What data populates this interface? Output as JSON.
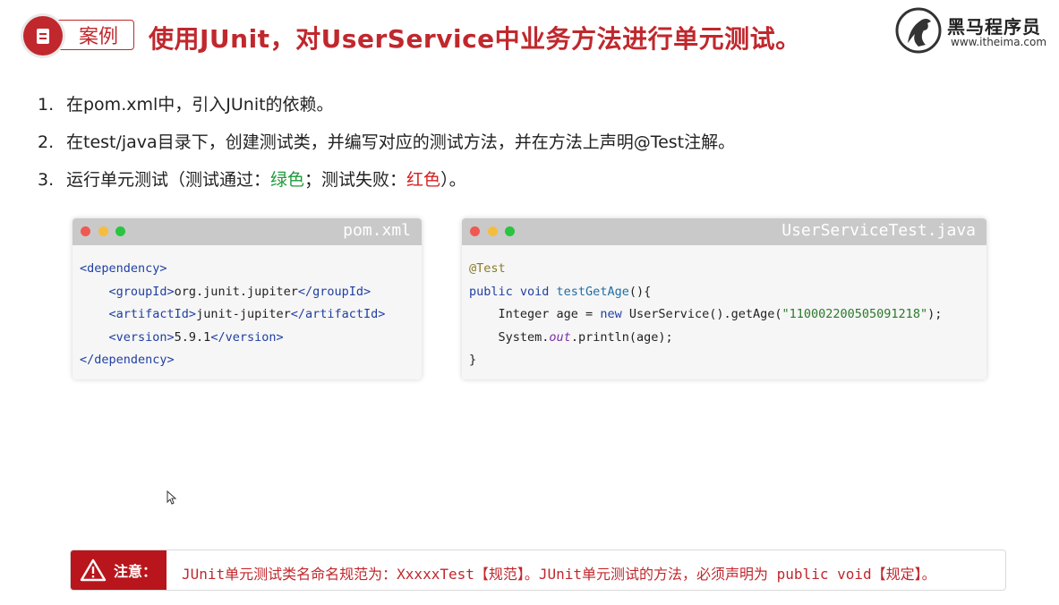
{
  "header": {
    "badge_label": "案例",
    "title": "使用JUnit，对UserService中业务方法进行单元测试。"
  },
  "brand": {
    "name": "黑马程序员",
    "url": "www.itheima.com"
  },
  "steps": [
    {
      "num": "1.",
      "text": "在pom.xml中，引入JUnit的依赖。"
    },
    {
      "num": "2.",
      "text": "在test/java目录下，创建测试类，并编写对应的测试方法，并在方法上声明@Test注解。"
    },
    {
      "num": "3.",
      "prefix": "运行单元测试（测试通过：",
      "green": "绿色",
      "middle": "；测试失败：",
      "red": "红色",
      "suffix": "）。"
    }
  ],
  "pom_panel": {
    "filename": "pom.xml",
    "lines": {
      "l1_tag": "<dependency>",
      "l2_open": "<groupId>",
      "l2_val": "org.junit.jupiter",
      "l2_close": "</groupId>",
      "l3_open": "<artifactId>",
      "l3_val": "junit-jupiter",
      "l3_close": "</artifactId>",
      "l4_open": "<version>",
      "l4_val": "5.9.1",
      "l4_close": "</version>",
      "l5_tag": "</dependency>"
    }
  },
  "test_panel": {
    "filename": "UserServiceTest.java",
    "lines": {
      "annotation": "@Test",
      "sig_kw": "public void",
      "sig_name": "testGetAge",
      "sig_rest": "(){",
      "l3_a": "Integer age = ",
      "l3_kw": "new",
      "l3_b": " UserService().getAge(",
      "l3_str": "\"110002200505091218\"",
      "l3_c": ");",
      "l4_a": "System.",
      "l4_out": "out",
      "l4_b": ".println(age);",
      "close": "}"
    }
  },
  "notice": {
    "label": "注意：",
    "text": "JUnit单元测试类名命名规范为：XxxxxTest【规范】。JUnit单元测试的方法，必须声明为 public void【规定】。"
  },
  "colors": {
    "accent": "#c0282d",
    "pass": "#1f9b3a",
    "fail": "#d4201f"
  }
}
